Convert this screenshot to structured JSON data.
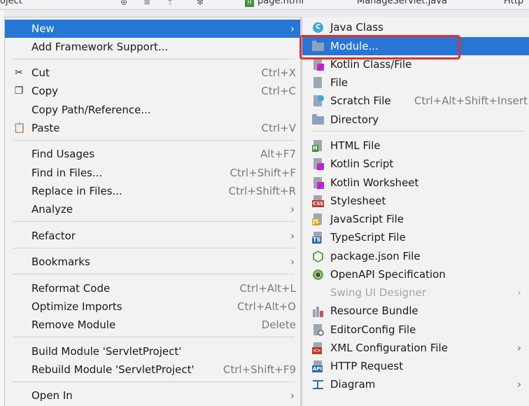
{
  "ide": {
    "project_label": "oject",
    "tabs": [
      {
        "label": "page.html",
        "badge": "H"
      },
      {
        "label": "ManageServlet.java"
      },
      {
        "label": "Http"
      }
    ]
  },
  "menu": {
    "items": [
      {
        "label": "New",
        "shortcut": "",
        "submenu": true,
        "icon": ""
      },
      {
        "label": "Add Framework Support...",
        "shortcut": "",
        "submenu": false,
        "icon": ""
      },
      {
        "label": "Cut",
        "shortcut": "Ctrl+X",
        "submenu": false,
        "icon": "scissors-icon"
      },
      {
        "label": "Copy",
        "shortcut": "Ctrl+C",
        "submenu": false,
        "icon": "copy-icon"
      },
      {
        "label": "Copy Path/Reference...",
        "shortcut": "",
        "submenu": false,
        "icon": ""
      },
      {
        "label": "Paste",
        "shortcut": "Ctrl+V",
        "submenu": false,
        "icon": "clipboard-icon"
      },
      {
        "label": "Find Usages",
        "shortcut": "Alt+F7",
        "submenu": false,
        "icon": ""
      },
      {
        "label": "Find in Files...",
        "shortcut": "Ctrl+Shift+F",
        "submenu": false,
        "icon": ""
      },
      {
        "label": "Replace in Files...",
        "shortcut": "Ctrl+Shift+R",
        "submenu": false,
        "icon": ""
      },
      {
        "label": "Analyze",
        "shortcut": "",
        "submenu": true,
        "icon": ""
      },
      {
        "label": "Refactor",
        "shortcut": "",
        "submenu": true,
        "icon": ""
      },
      {
        "label": "Bookmarks",
        "shortcut": "",
        "submenu": true,
        "icon": ""
      },
      {
        "label": "Reformat Code",
        "shortcut": "Ctrl+Alt+L",
        "submenu": false,
        "icon": ""
      },
      {
        "label": "Optimize Imports",
        "shortcut": "Ctrl+Alt+O",
        "submenu": false,
        "icon": ""
      },
      {
        "label": "Remove Module",
        "shortcut": "Delete",
        "submenu": false,
        "icon": ""
      },
      {
        "label": "Build Module 'ServletProject'",
        "shortcut": "",
        "submenu": false,
        "icon": ""
      },
      {
        "label": "Rebuild Module 'ServletProject'",
        "shortcut": "Ctrl+Shift+F9",
        "submenu": false,
        "icon": ""
      },
      {
        "label": "Open In",
        "shortcut": "",
        "submenu": true,
        "icon": ""
      }
    ]
  },
  "submenu": {
    "items": [
      {
        "label": "Java Class",
        "shortcut": "",
        "icon": "java-class-icon",
        "glyph": "C"
      },
      {
        "label": "Module...",
        "shortcut": "",
        "icon": "module-folder-icon"
      },
      {
        "label": "Kotlin Class/File",
        "shortcut": "",
        "icon": "kotlin-file-icon"
      },
      {
        "label": "File",
        "shortcut": "",
        "icon": "file-icon"
      },
      {
        "label": "Scratch File",
        "shortcut": "Ctrl+Alt+Shift+Insert",
        "icon": "scratch-file-icon"
      },
      {
        "label": "Directory",
        "shortcut": "",
        "icon": "directory-icon"
      },
      {
        "label": "HTML File",
        "shortcut": "",
        "icon": "html-file-icon",
        "tag": "H"
      },
      {
        "label": "Kotlin Script",
        "shortcut": "",
        "icon": "kotlin-script-icon"
      },
      {
        "label": "Kotlin Worksheet",
        "shortcut": "",
        "icon": "kotlin-worksheet-icon"
      },
      {
        "label": "Stylesheet",
        "shortcut": "",
        "icon": "css-file-icon",
        "tag": "CSS"
      },
      {
        "label": "JavaScript File",
        "shortcut": "",
        "icon": "js-file-icon",
        "tag": "JS"
      },
      {
        "label": "TypeScript File",
        "shortcut": "",
        "icon": "ts-file-icon",
        "tag": "TS"
      },
      {
        "label": "package.json File",
        "shortcut": "",
        "icon": "nodejs-icon"
      },
      {
        "label": "OpenAPI Specification",
        "shortcut": "",
        "icon": "openapi-icon"
      },
      {
        "label": "Swing UI Designer",
        "shortcut": "",
        "icon": "",
        "disabled": true,
        "submenu": true
      },
      {
        "label": "Resource Bundle",
        "shortcut": "",
        "icon": "resource-bundle-icon"
      },
      {
        "label": "EditorConfig File",
        "shortcut": "",
        "icon": "editorconfig-icon"
      },
      {
        "label": "XML Configuration File",
        "shortcut": "",
        "icon": "xml-file-icon",
        "submenu": true,
        "tag": "<>"
      },
      {
        "label": "HTTP Request",
        "shortcut": "",
        "icon": "http-request-icon",
        "tag": "API"
      },
      {
        "label": "Diagram",
        "shortcut": "",
        "icon": "diagram-icon",
        "submenu": true
      }
    ]
  },
  "arrow_glyph": "›",
  "colors": {
    "selection": "#2776d6",
    "annotation_box": "#e5302b",
    "menu_bg": "#f2f2f2"
  }
}
